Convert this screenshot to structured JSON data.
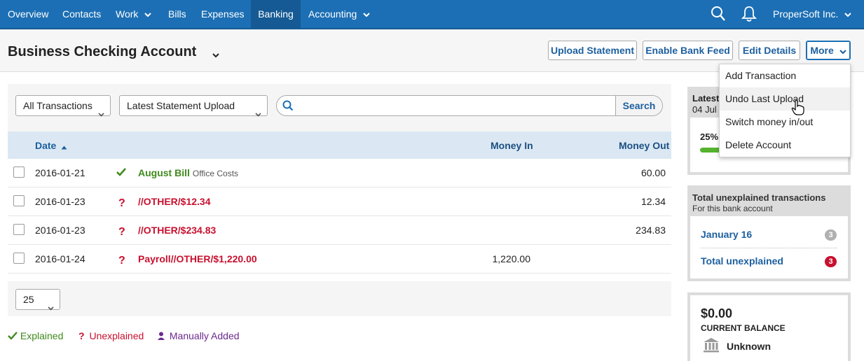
{
  "nav": {
    "items": [
      {
        "label": "Overview"
      },
      {
        "label": "Contacts"
      },
      {
        "label": "Work"
      },
      {
        "label": "Bills"
      },
      {
        "label": "Expenses"
      },
      {
        "label": "Banking"
      },
      {
        "label": "Accounting"
      }
    ],
    "company": "ProperSoft Inc."
  },
  "header": {
    "title": "Business Checking Account",
    "buttons": {
      "upload": "Upload Statement",
      "bank_feed": "Enable Bank Feed",
      "edit": "Edit Details",
      "more": "More"
    }
  },
  "filters": {
    "type": "All Transactions",
    "upload": "Latest Statement Upload",
    "search_placeholder": "",
    "search_button": "Search"
  },
  "table": {
    "columns": {
      "date": "Date",
      "money_in": "Money In",
      "money_out": "Money Out"
    },
    "rows": [
      {
        "date": "2016-01-21",
        "status": "explained",
        "description": "August Bill",
        "sub": "Office Costs",
        "money_in": "",
        "money_out": "60.00"
      },
      {
        "date": "2016-01-23",
        "status": "unexplained",
        "description": "//OTHER/$12.34",
        "sub": "",
        "money_in": "",
        "money_out": "12.34"
      },
      {
        "date": "2016-01-23",
        "status": "unexplained",
        "description": "//OTHER/$234.83",
        "sub": "",
        "money_in": "",
        "money_out": "234.83"
      },
      {
        "date": "2016-01-24",
        "status": "unexplained",
        "description": "Payroll//OTHER/$1,220.00",
        "sub": "",
        "money_in": "1,220.00",
        "money_out": ""
      }
    ]
  },
  "pager": {
    "per_page": "25"
  },
  "legend": {
    "explained": "Explained",
    "unexplained": "Unexplained",
    "manual": "Manually Added"
  },
  "sidebar": {
    "latest": {
      "title": "Latest",
      "date": "04 Jul",
      "progress_label": "25%",
      "progress": 0.25
    },
    "unexplained": {
      "title": "Total unexplained transactions",
      "subtitle": "For this bank account",
      "month_label": "January 16",
      "month_count": "3",
      "total_label": "Total unexplained",
      "total_count": "3"
    },
    "balance": {
      "amount": "$0.00",
      "label": "CURRENT BALANCE",
      "bank": "Unknown"
    }
  },
  "more_menu": {
    "items": [
      {
        "label": "Add Transaction"
      },
      {
        "label": "Undo Last Upload"
      },
      {
        "label": "Switch money in/out"
      },
      {
        "label": "Delete Account"
      }
    ]
  },
  "colors": {
    "nav": "#1c6fb4",
    "explained": "#3f8a1c",
    "unexplained": "#c8102e",
    "manual": "#6b2a8f"
  }
}
